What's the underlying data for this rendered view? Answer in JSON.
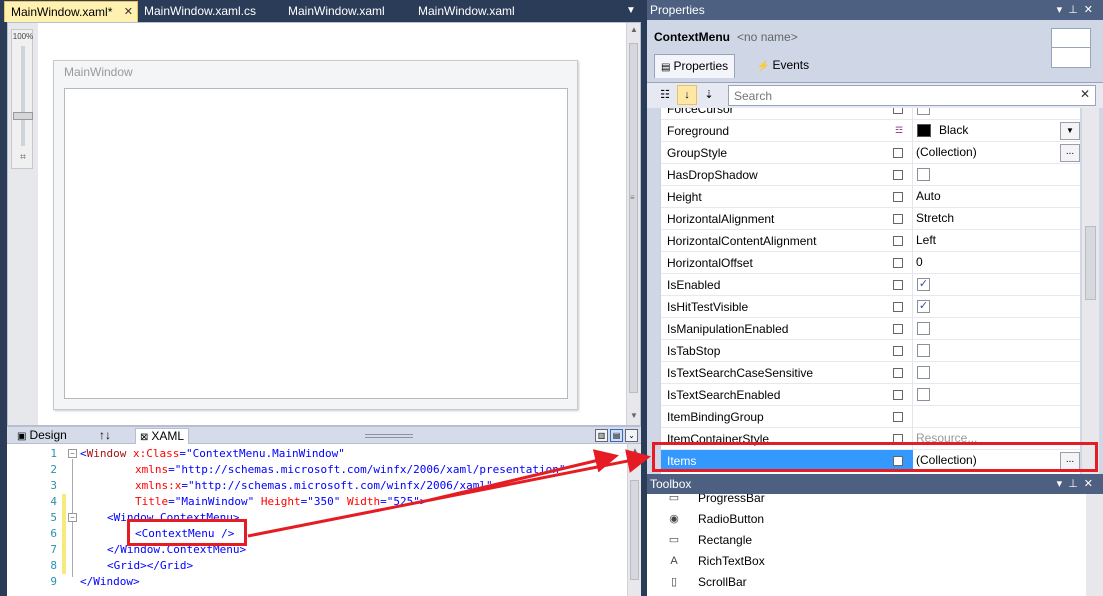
{
  "doc_tabs": [
    {
      "label": "MainWindow.xaml*",
      "active": true
    },
    {
      "label": "MainWindow.xaml.cs",
      "active": false
    },
    {
      "label": "MainWindow.xaml",
      "active": false
    },
    {
      "label": "MainWindow.xaml",
      "active": false
    }
  ],
  "designer": {
    "zoom": "100%",
    "window_title": "MainWindow"
  },
  "split_bar": {
    "design_label": "Design",
    "swap_label": "↑↓",
    "xaml_label": "XAML"
  },
  "code_lines": [
    {
      "num": "1",
      "text": ""
    },
    {
      "num": "2",
      "text": ""
    },
    {
      "num": "3",
      "text": ""
    },
    {
      "num": "4",
      "text": ""
    },
    {
      "num": "5",
      "text": ""
    },
    {
      "num": "6",
      "text": ""
    },
    {
      "num": "7",
      "text": ""
    },
    {
      "num": "8",
      "text": ""
    },
    {
      "num": "9",
      "text": ""
    }
  ],
  "code": {
    "l1_open": "<",
    "l1_tag": "Window",
    "l1_attr": " x:Class",
    "l1_eq": "=",
    "l1_val": "\"ContextMenu.MainWindow\"",
    "l2_attr": "xmlns",
    "l2_val": "\"http://schemas.microsoft.com/winfx/2006/xaml/presentation\"",
    "l3_attr": "xmlns:x",
    "l3_val": "\"http://schemas.microsoft.com/winfx/2006/xaml\"",
    "l4_attr1": "Title",
    "l4_val1": "\"MainWindow\"",
    "l4_attr2": " Height",
    "l4_val2": "\"350\"",
    "l4_attr3": " Width",
    "l4_val3": "\"525\"",
    "l4_close": ">",
    "l5_text": "<Window.ContextMenu>",
    "l6_text": "<ContextMenu />",
    "l7_text": "</Window.ContextMenu>",
    "l8_text": "<Grid></Grid>",
    "l9_text": "</Window>"
  },
  "properties": {
    "panel_title": "Properties",
    "element_type": "ContextMenu",
    "element_name": "<no name>",
    "tab_properties": "Properties",
    "tab_events": "Events",
    "search_placeholder": "Search",
    "rows": [
      {
        "name": "ForceCursor",
        "kind": "check",
        "checked": false
      },
      {
        "name": "Foreground",
        "kind": "brush",
        "value": "Black",
        "color": "#000000"
      },
      {
        "name": "GroupStyle",
        "kind": "ellipsis",
        "value": "(Collection)"
      },
      {
        "name": "HasDropShadow",
        "kind": "check",
        "checked": false
      },
      {
        "name": "Height",
        "kind": "text",
        "value": "Auto"
      },
      {
        "name": "HorizontalAlignment",
        "kind": "text",
        "value": "Stretch"
      },
      {
        "name": "HorizontalContentAlignment",
        "kind": "text",
        "value": "Left"
      },
      {
        "name": "HorizontalOffset",
        "kind": "text",
        "value": "0"
      },
      {
        "name": "IsEnabled",
        "kind": "check",
        "checked": true
      },
      {
        "name": "IsHitTestVisible",
        "kind": "check",
        "checked": true
      },
      {
        "name": "IsManipulationEnabled",
        "kind": "check",
        "checked": false
      },
      {
        "name": "IsTabStop",
        "kind": "check",
        "checked": false
      },
      {
        "name": "IsTextSearchCaseSensitive",
        "kind": "check",
        "checked": false
      },
      {
        "name": "IsTextSearchEnabled",
        "kind": "check",
        "checked": false
      },
      {
        "name": "ItemBindingGroup",
        "kind": "text",
        "value": ""
      },
      {
        "name": "ItemContainerStyle",
        "kind": "muted",
        "value": "Resource..."
      },
      {
        "name": "Items",
        "kind": "ellipsis",
        "value": "(Collection)",
        "selected": true
      }
    ],
    "ellipsis_label": "...",
    "dropdown_label": "▼",
    "check_glyph": "✓"
  },
  "toolbox": {
    "panel_title": "Toolbox",
    "items": [
      {
        "label": "ProgressBar",
        "icon": "progressbar-icon",
        "glyph": "▭"
      },
      {
        "label": "RadioButton",
        "icon": "radiobutton-icon",
        "glyph": "◉"
      },
      {
        "label": "Rectangle",
        "icon": "rectangle-icon",
        "glyph": "▭"
      },
      {
        "label": "RichTextBox",
        "icon": "richtextbox-icon",
        "glyph": "A"
      },
      {
        "label": "ScrollBar",
        "icon": "scrollbar-icon",
        "glyph": "▯"
      }
    ]
  },
  "colors": {
    "accent_selection": "#3399ff",
    "annotation_red": "#e51c23",
    "chrome_dark": "#2b3c59"
  }
}
